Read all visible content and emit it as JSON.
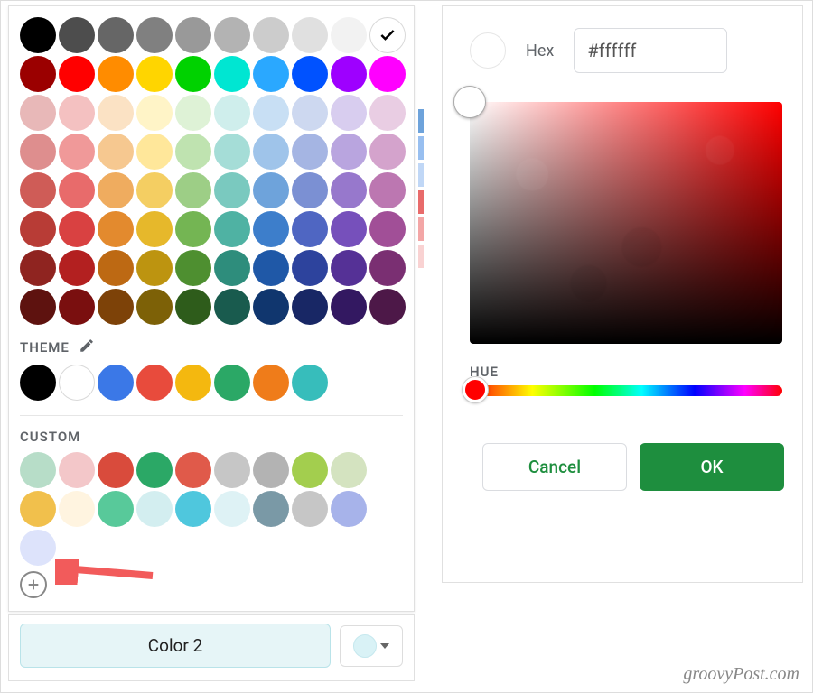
{
  "paletteStandard": {
    "rows": [
      [
        "#000000",
        "#4d4d4d",
        "#666666",
        "#808080",
        "#999999",
        "#b3b3b3",
        "#cccccc",
        "#e0e0e0",
        "#f2f2f2",
        "#ffffff"
      ],
      [
        "#9b0000",
        "#ff0000",
        "#ff8c00",
        "#ffd500",
        "#00d200",
        "#00e6d2",
        "#2aa8ff",
        "#0052ff",
        "#9e00ff",
        "#ff00ff"
      ],
      [
        "#e8b8b8",
        "#f4c1c1",
        "#fbe2c4",
        "#fff4c7",
        "#def2d6",
        "#cfeeec",
        "#c8dff4",
        "#cdd8f0",
        "#d8cdef",
        "#e9cde3"
      ],
      [
        "#de8e8e",
        "#f09999",
        "#f6c890",
        "#ffe79a",
        "#bfe3b0",
        "#a5ddd7",
        "#9fc4ea",
        "#a5b5e3",
        "#b9a5df",
        "#d4a3cc"
      ],
      [
        "#cf5c57",
        "#e86b6b",
        "#efac5f",
        "#f4ce62",
        "#9dce86",
        "#7ac9bf",
        "#6ea3db",
        "#7b90d3",
        "#9778cc",
        "#bc77b1"
      ],
      [
        "#b83c36",
        "#d94141",
        "#e38a2e",
        "#e6b82b",
        "#74b553",
        "#4fb2a3",
        "#3d7ecb",
        "#4f66c2",
        "#7650bb",
        "#a14f97"
      ],
      [
        "#8f2420",
        "#b32020",
        "#bd6913",
        "#bd9410",
        "#4e8f30",
        "#2e8d7c",
        "#1f58a7",
        "#2d439d",
        "#553196",
        "#7a2f72"
      ],
      [
        "#5e120f",
        "#7a0f0f",
        "#7d4208",
        "#7d6107",
        "#2e5c1b",
        "#195b4e",
        "#10366e",
        "#182765",
        "#331861",
        "#4d1848"
      ]
    ],
    "selectedIndex": 9
  },
  "themeSection": {
    "label": "THEME",
    "colors": [
      "#000000",
      "#ffffff",
      "#3b78e7",
      "#e84b3c",
      "#f4b80f",
      "#2ba866",
      "#ef7c1a",
      "#37bdbb"
    ]
  },
  "customSection": {
    "label": "CUSTOM",
    "colors": [
      "#b7ddc8",
      "#f3c7c9",
      "#d94b3c",
      "#2ba866",
      "#e05a4a",
      "#c6c6c6",
      "#b3b3b3",
      "#a3ce4e",
      "#d4e3c0",
      "#f1c04c",
      "#fff4e0",
      "#58c99a",
      "#d3eef0",
      "#4fc7dd",
      "#def2f5",
      "#7a99a6",
      "#c6c6c6",
      "#a7b3ea",
      "#dde3fb"
    ]
  },
  "peekColors": [
    "#6ea3db",
    "#98bff0",
    "#c0d7f6",
    "#e86b6b",
    "#f3a6a6",
    "#f9d2d2"
  ],
  "color2": {
    "label": "Color 2",
    "swatch": "#d9f2f6"
  },
  "customPicker": {
    "hexLabel": "Hex",
    "hexValue": "#ffffff",
    "hueLabel": "HUE",
    "cancel": "Cancel",
    "ok": "OK"
  },
  "credit": "groovyPost.com"
}
